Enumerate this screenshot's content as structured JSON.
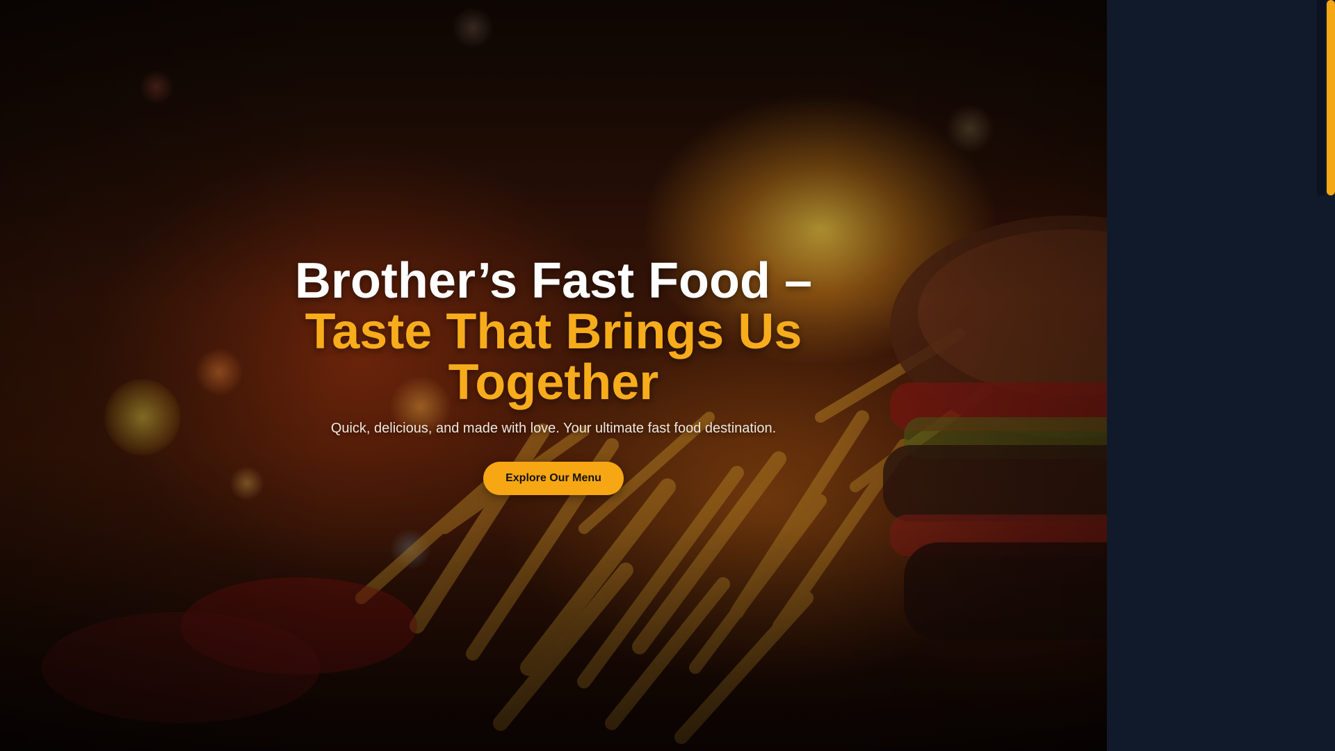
{
  "hero": {
    "title_line1": "Brother’s Fast Food –",
    "title_accent": "Taste That Brings Us Together",
    "subtitle": "Quick, delicious, and made with love. Your ultimate fast food destination.",
    "cta_label": "Explore Our Menu"
  },
  "colors": {
    "accent": "#f7ac1c",
    "button": "#f7a614",
    "panel": "#111a2b",
    "scrollbar_thumb": "#f5a816"
  },
  "scrollbar": {
    "position_fraction": 0.0,
    "visible_fraction": 0.26
  }
}
